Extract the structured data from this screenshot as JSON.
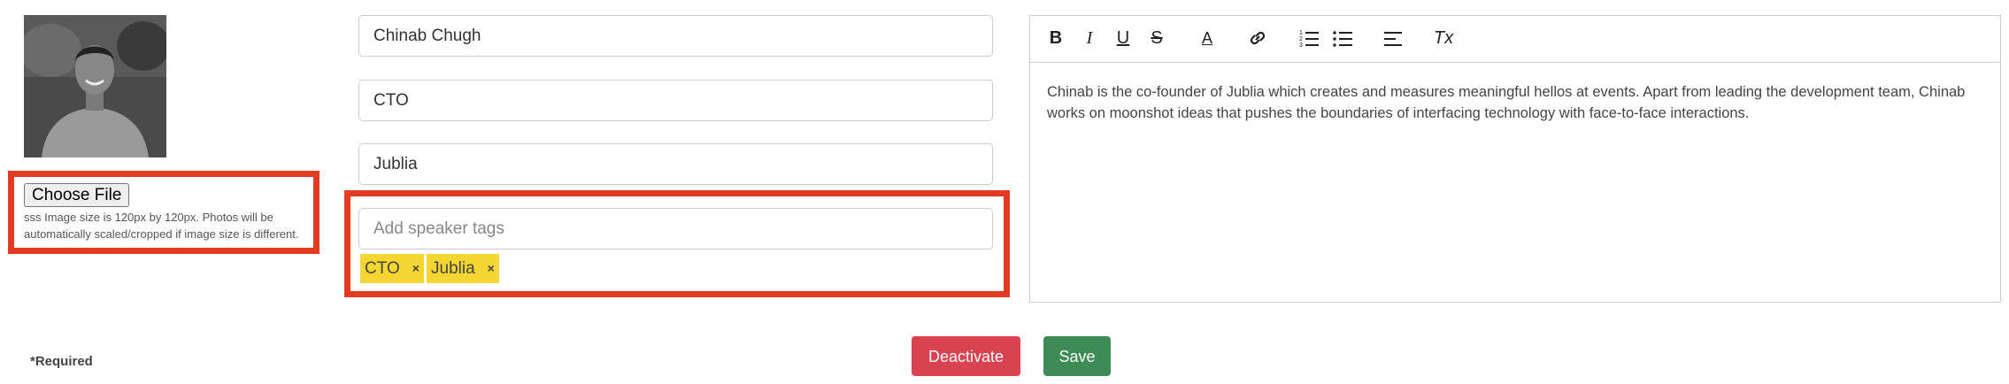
{
  "photo": {
    "alt": "speaker photo"
  },
  "file_upload": {
    "button_label": "Choose File",
    "hint": "sss Image size is 120px by 120px. Photos will be automatically scaled/cropped if image size is different."
  },
  "form": {
    "name": "Chinab Chugh",
    "title": "CTO",
    "company": "Jublia",
    "tags_placeholder": "Add speaker tags",
    "tags": [
      "CTO",
      "Jublia"
    ],
    "tag_remove_glyph": "×"
  },
  "editor": {
    "toolbar": {
      "bold": "B",
      "italic": "I",
      "underline": "U",
      "strike": "S",
      "font_color": "A",
      "link": "link",
      "ordered_list": "ol",
      "bullet_list": "ul",
      "align": "align",
      "clear": "Tx"
    },
    "bio": "Chinab is the co-founder of Jublia which creates and measures meaningful hellos at events. Apart from leading the development team, Chinab works on moonshot ideas that pushes the boundaries of interfacing technology with face-to-face interactions."
  },
  "footer": {
    "required_note": "*Required",
    "deactivate_label": "Deactivate",
    "save_label": "Save"
  },
  "colors": {
    "highlight": "#e33b22",
    "tag": "#f4d633",
    "deactivate": "#d9424f",
    "save": "#3d8c55"
  }
}
